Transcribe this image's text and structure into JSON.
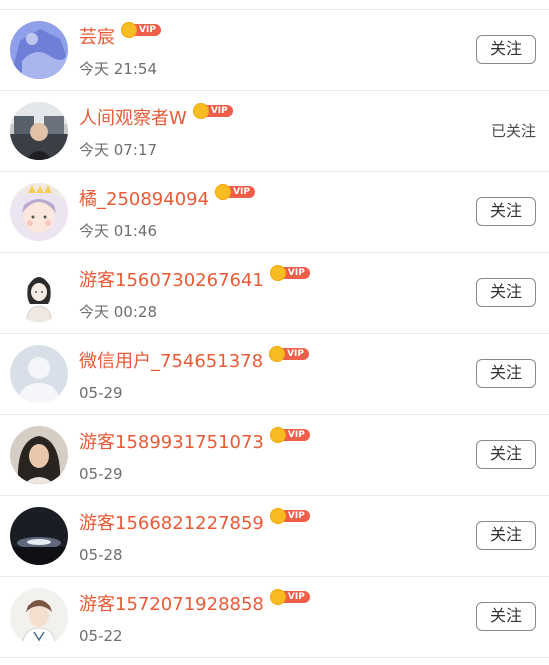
{
  "colors": {
    "name": "#e95a36",
    "time": "#6e6e6e",
    "vip_badge": "#ef5e49",
    "vip_crown": "#f7bc22",
    "divider": "#ececec",
    "button_border": "#8a8a8a"
  },
  "vip_label": "VIP",
  "users": [
    {
      "name": "芸宸",
      "time": "今天 21:54",
      "action": "关注",
      "followed": false,
      "avatar": "avatar-blue-icon"
    },
    {
      "name": "人间观察者W",
      "time": "今天 07:17",
      "action": "已关注",
      "followed": true,
      "avatar": "avatar-photo-icon"
    },
    {
      "name": "橘_250894094",
      "time": "今天 01:46",
      "action": "关注",
      "followed": false,
      "avatar": "avatar-anime-icon"
    },
    {
      "name": "游客1560730267641",
      "time": "今天 00:28",
      "action": "关注",
      "followed": false,
      "avatar": "avatar-sketch-icon"
    },
    {
      "name": "微信用户_754651378",
      "time": "05-29",
      "action": "关注",
      "followed": false,
      "avatar": "avatar-default-icon"
    },
    {
      "name": "游客1589931751073",
      "time": "05-29",
      "action": "关注",
      "followed": false,
      "avatar": "avatar-girl-icon"
    },
    {
      "name": "游客1566821227859",
      "time": "05-28",
      "action": "关注",
      "followed": false,
      "avatar": "avatar-night-icon"
    },
    {
      "name": "游客1572071928858",
      "time": "05-22",
      "action": "关注",
      "followed": false,
      "avatar": "avatar-boy-icon"
    }
  ]
}
